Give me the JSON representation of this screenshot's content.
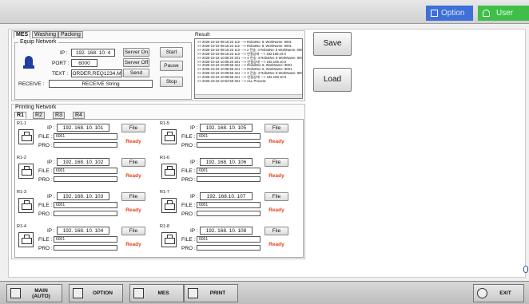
{
  "topbar": {
    "option_label": "Option",
    "user_label": "User",
    "option_color": "#3f6fd8",
    "user_color": "#3fbf47"
  },
  "top_panel": {
    "tabs": [
      "MES",
      "Washing",
      "Packing"
    ],
    "equip": {
      "title": "Equip Network",
      "ip_label": "IP :",
      "ip_value": "192. 168. 10. 4",
      "port_label": "PORT :",
      "port_value": "6000",
      "text_label": "TEXT :",
      "text_value": "ORDER,REQ1234,M",
      "receive_label": "RECEIVE :",
      "receive_value": "RECEIVE String",
      "buttons": {
        "server_on": "Server On",
        "server_off": "Server Off",
        "send": "Send",
        "start": "Start",
        "pause": "Pause",
        "stop": "Stop"
      }
    },
    "result": {
      "title": "Result",
      "lines": [
        ">> 2025-10-22-08:15:23 112 ---> RobotNo: 8, WorkName: 9001",
        ">> 2025-10-22-08:15:23 112 ---> RobotNo: 8, WorkName: 9001",
        ">> 2025-10-22-08:15:23 113 ---> 2 전송: 4 RobotNo: 8 WorkName: 9001",
        ">> 2025-10-22-08:15:23 113 ---> 연결상태 ---> 192.168.10.0",
        ">> 2025-10-22-10:08:20 201 ---> 4 전송: 4 RobotNo: 8 WorkName: 9001",
        ">> 2025-10-22-10:08:20 201 ---> 연결상태 ---> 192.168.10.0",
        ">> 2025-10-22-10:08:56 421 ---> RobotNo: 8, WorkName: 9001",
        ">> 2025-10-22-10:08:56 421 ---> RobotNo: 8, WorkName: 9001",
        ">> 2025-10-22-10:08:56 421 ---> 4 전송: 4 RobotNo: 8 WorkName: 9001",
        ">> 2025-10-22-10:08:56 421 ---> 연결상태 ---> 192.168.10.0",
        ">> 2025-10-22-10:54:59 401 ---> ALL Process"
      ]
    }
  },
  "side_buttons": {
    "save": "Save",
    "load": "Load"
  },
  "printing": {
    "title": "Printing Network",
    "tabs": [
      "R1",
      "R2",
      "R3",
      "R4"
    ],
    "ip_label": "IP :",
    "file_label": "FILE :",
    "pro_label": "PRO :",
    "file_button": "File",
    "units": [
      {
        "name": "R1-1",
        "ip": "192. 168. 10. 101",
        "file": "6001",
        "status": "Ready"
      },
      {
        "name": "R1-2",
        "ip": "192. 168. 10. 102",
        "file": "6001",
        "status": "Ready"
      },
      {
        "name": "R1-3",
        "ip": "192. 168. 10. 103",
        "file": "6001",
        "status": "Ready"
      },
      {
        "name": "R1-4",
        "ip": "192. 168. 10. 104",
        "file": "6001",
        "status": "Ready"
      },
      {
        "name": "R1-5",
        "ip": "192. 168. 10. 105",
        "file": "6001",
        "status": "Ready"
      },
      {
        "name": "R1-6",
        "ip": "192. 168. 10. 106",
        "file": "6001",
        "status": "Ready"
      },
      {
        "name": "R1-7",
        "ip": "192. 168.10. 107",
        "file": "6001",
        "status": "Ready"
      },
      {
        "name": "R1-8",
        "ip": "192. 168. 10. 108",
        "file": "6001",
        "status": "Ready"
      }
    ]
  },
  "bottombar": {
    "main": "MAIN\n(AUTO)",
    "option": "OPTION",
    "mes": "MES",
    "print": "PRINT",
    "exit": "EXIT"
  }
}
